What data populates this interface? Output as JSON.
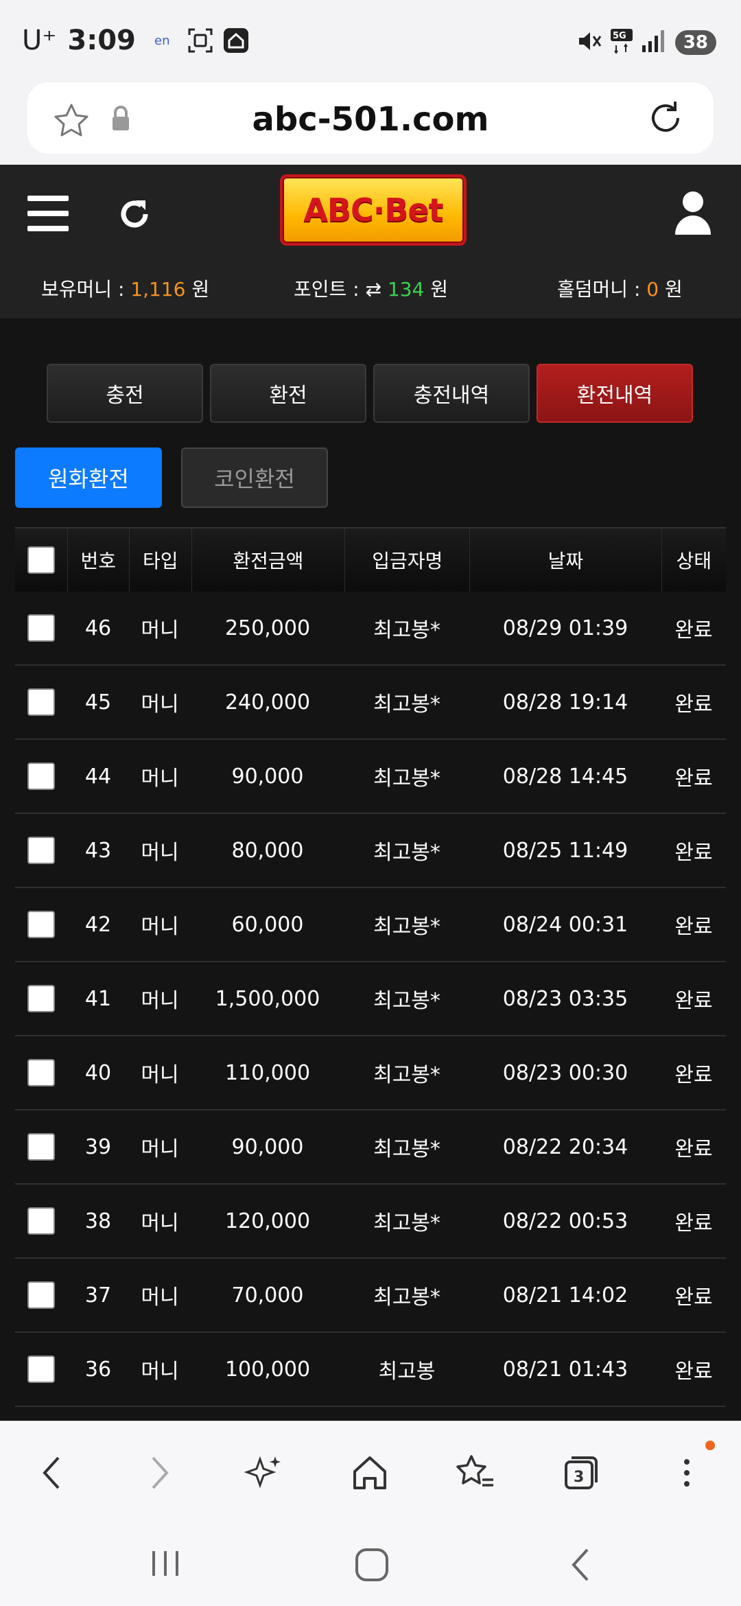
{
  "status_bar": {
    "carrier": "U⁺",
    "time": "3:09",
    "network": "5G",
    "battery": "38"
  },
  "browser": {
    "url": "abc-501.com"
  },
  "site": {
    "logo_text": "ABC·Bet",
    "balances": {
      "money_label": "보유머니 :",
      "money_value": "1,116",
      "money_unit": "원",
      "point_label": "포인트 :",
      "point_value": "134",
      "point_unit": "원",
      "hold_label": "홀덤머니 :",
      "hold_value": "0",
      "hold_unit": "원"
    },
    "tabs": [
      "충전",
      "환전",
      "충전내역",
      "환전내역"
    ],
    "active_tab": "환전내역",
    "subtabs": [
      "원화환전",
      "코인환전"
    ],
    "active_subtab": "원화환전"
  },
  "table": {
    "headers": [
      "번호",
      "타입",
      "환전금액",
      "입금자명",
      "날짜",
      "상태"
    ],
    "rows": [
      {
        "no": "46",
        "type": "머니",
        "amount": "250,000",
        "name": "최고봉*",
        "date": "08/29 01:39",
        "status": "완료"
      },
      {
        "no": "45",
        "type": "머니",
        "amount": "240,000",
        "name": "최고봉*",
        "date": "08/28 19:14",
        "status": "완료"
      },
      {
        "no": "44",
        "type": "머니",
        "amount": "90,000",
        "name": "최고봉*",
        "date": "08/28 14:45",
        "status": "완료"
      },
      {
        "no": "43",
        "type": "머니",
        "amount": "80,000",
        "name": "최고봉*",
        "date": "08/25 11:49",
        "status": "완료"
      },
      {
        "no": "42",
        "type": "머니",
        "amount": "60,000",
        "name": "최고봉*",
        "date": "08/24 00:31",
        "status": "완료"
      },
      {
        "no": "41",
        "type": "머니",
        "amount": "1,500,000",
        "name": "최고봉*",
        "date": "08/23 03:35",
        "status": "완료"
      },
      {
        "no": "40",
        "type": "머니",
        "amount": "110,000",
        "name": "최고봉*",
        "date": "08/23 00:30",
        "status": "완료"
      },
      {
        "no": "39",
        "type": "머니",
        "amount": "90,000",
        "name": "최고봉*",
        "date": "08/22 20:34",
        "status": "완료"
      },
      {
        "no": "38",
        "type": "머니",
        "amount": "120,000",
        "name": "최고봉*",
        "date": "08/22 00:53",
        "status": "완료"
      },
      {
        "no": "37",
        "type": "머니",
        "amount": "70,000",
        "name": "최고봉*",
        "date": "08/21 14:02",
        "status": "완료"
      },
      {
        "no": "36",
        "type": "머니",
        "amount": "100,000",
        "name": "최고봉",
        "date": "08/21 01:43",
        "status": "완료"
      }
    ]
  },
  "bottom_bar": {
    "tab_count": "3",
    "icons": [
      "back-icon",
      "forward-icon",
      "ai-sparkle-icon",
      "home-icon",
      "bookmarks-icon",
      "tabs-icon",
      "menu-icon"
    ]
  },
  "colors": {
    "accent_blue": "#0d7bff",
    "active_tab_red": "#a31a1a",
    "money_orange": "#f7931e",
    "point_green": "#39d353"
  }
}
